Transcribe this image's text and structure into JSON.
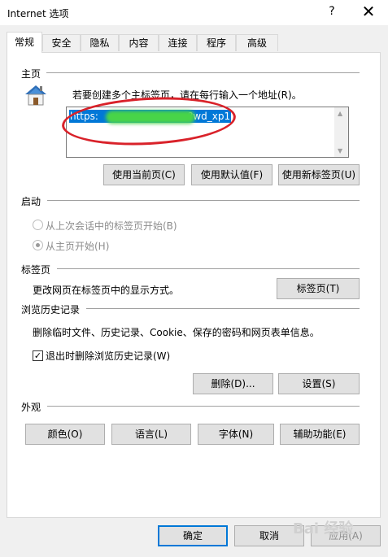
{
  "window": {
    "title": "Internet 选项",
    "help_label": "?",
    "close_label": "✕"
  },
  "tabs": [
    "常规",
    "安全",
    "隐私",
    "内容",
    "连接",
    "程序",
    "高级"
  ],
  "homepage": {
    "section": "主页",
    "instruction": "若要创建多个主标签页，请在每行输入一个地址(R)。",
    "url_visible_start": "https:",
    "url_visible_end": "?wd_xp1",
    "btn_current": "使用当前页(C)",
    "btn_default": "使用默认值(F)",
    "btn_newtab": "使用新标签页(U)"
  },
  "startup": {
    "section": "启动",
    "option_last_session": "从上次会话中的标签页开始(B)",
    "option_homepage": "从主页开始(H)"
  },
  "tabs_section": {
    "section": "标签页",
    "description": "更改网页在标签页中的显示方式。",
    "btn": "标签页(T)"
  },
  "history": {
    "section": "浏览历史记录",
    "description": "删除临时文件、历史记录、Cookie、保存的密码和网页表单信息。",
    "checkbox_label": "退出时删除浏览历史记录(W)",
    "checkbox_mark": "✓",
    "btn_delete": "删除(D)...",
    "btn_settings": "设置(S)"
  },
  "appearance": {
    "section": "外观",
    "btn_colors": "颜色(O)",
    "btn_languages": "语言(L)",
    "btn_fonts": "字体(N)",
    "btn_accessibility": "辅助功能(E)"
  },
  "footer": {
    "ok": "确定",
    "cancel": "取消",
    "apply": "应用(A)"
  },
  "watermark": "Bai 经验"
}
